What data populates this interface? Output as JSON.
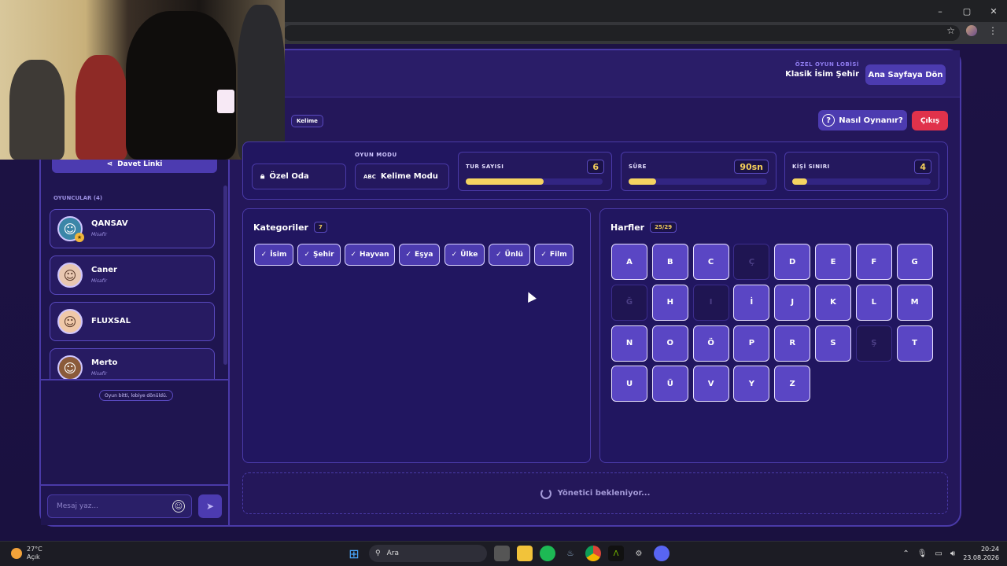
{
  "browser": {
    "window_controls": [
      "–",
      "▢",
      "✕"
    ]
  },
  "lobby": {
    "kicker": "ÖZEL OYUN LOBİSİ",
    "name": "Klasik İsim Şehir",
    "home_button": "Ana Sayfaya Dön"
  },
  "sidebar": {
    "invite_button": "Davet Linki",
    "players_label": "OYUNCULAR (4)",
    "players": [
      {
        "name": "QANSAV",
        "role": "Misafir",
        "host": true
      },
      {
        "name": "Caner",
        "role": "Misafir",
        "host": false
      },
      {
        "name": "FLUXSAL",
        "role": "",
        "host": false
      },
      {
        "name": "Merto",
        "role": "Misafir",
        "host": false
      }
    ],
    "system_message": "Oyun bitti, lobiye dönüldü.",
    "chat_placeholder": "Mesaj yaz..."
  },
  "game": {
    "mode_tag": "Kelime",
    "help_button": "Nasıl Oynanır?",
    "exit_button": "Çıkış",
    "room_type": "Özel Oda",
    "mode_label": "OYUN MODU",
    "mode_value": "Kelime Modu",
    "stats": [
      {
        "label": "TUR SAYISI",
        "value": "6",
        "fill": 0.57
      },
      {
        "label": "SÜRE",
        "value": "90sn",
        "fill": 0.2
      },
      {
        "label": "KİŞİ SINIRI",
        "value": "4",
        "fill": 0.11
      }
    ],
    "categories_title": "Kategoriler",
    "categories_count": "7",
    "categories": [
      "İsim",
      "Şehir",
      "Hayvan",
      "Eşya",
      "Ülke",
      "Ünlü",
      "Film"
    ],
    "letters_title": "Harfler",
    "letters_count": "25/29",
    "letters": [
      {
        "l": "A",
        "on": true
      },
      {
        "l": "B",
        "on": true
      },
      {
        "l": "C",
        "on": true
      },
      {
        "l": "Ç",
        "on": false
      },
      {
        "l": "D",
        "on": true
      },
      {
        "l": "E",
        "on": true
      },
      {
        "l": "F",
        "on": true
      },
      {
        "l": "G",
        "on": true
      },
      {
        "l": "Ğ",
        "on": false
      },
      {
        "l": "H",
        "on": true
      },
      {
        "l": "I",
        "on": false
      },
      {
        "l": "İ",
        "on": true
      },
      {
        "l": "J",
        "on": true
      },
      {
        "l": "K",
        "on": true
      },
      {
        "l": "L",
        "on": true
      },
      {
        "l": "M",
        "on": true
      },
      {
        "l": "N",
        "on": true
      },
      {
        "l": "O",
        "on": true
      },
      {
        "l": "Ö",
        "on": true
      },
      {
        "l": "P",
        "on": true
      },
      {
        "l": "R",
        "on": true
      },
      {
        "l": "S",
        "on": true
      },
      {
        "l": "Ş",
        "on": false
      },
      {
        "l": "T",
        "on": true
      },
      {
        "l": "U",
        "on": true
      },
      {
        "l": "Ü",
        "on": true
      },
      {
        "l": "V",
        "on": true
      },
      {
        "l": "Y",
        "on": true
      },
      {
        "l": "Z",
        "on": true
      }
    ],
    "waiting_text": "Yönetici bekleniyor..."
  },
  "taskbar": {
    "temperature": "27°C",
    "weather": "Açık",
    "search": "Ara",
    "time": "20:24",
    "date": "23.08.2026"
  }
}
